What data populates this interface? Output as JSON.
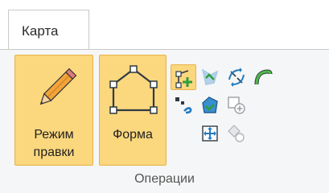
{
  "tabs": [
    {
      "label": "Карта"
    }
  ],
  "buttons": {
    "edit_mode": {
      "line1": "Режим",
      "line2": "правки"
    },
    "shape": {
      "label": "Форма"
    }
  },
  "group": {
    "label": "Операции"
  },
  "colors": {
    "active_fill": "#fbd77e",
    "active_border": "#e8b24a",
    "icon_blue": "#1f7ac0",
    "icon_green": "#2f9e3a",
    "ribbon_bg": "#f5f6f7"
  },
  "icons": [
    "pencil-icon",
    "polygon-shape-icon",
    "add-vertex-icon",
    "continue-feature-icon",
    "reshape-icon",
    "flip-line-icon",
    "curve-icon",
    "split-polygon-icon",
    "merge-icon",
    "move-icon",
    "erase-vertex-icon"
  ]
}
